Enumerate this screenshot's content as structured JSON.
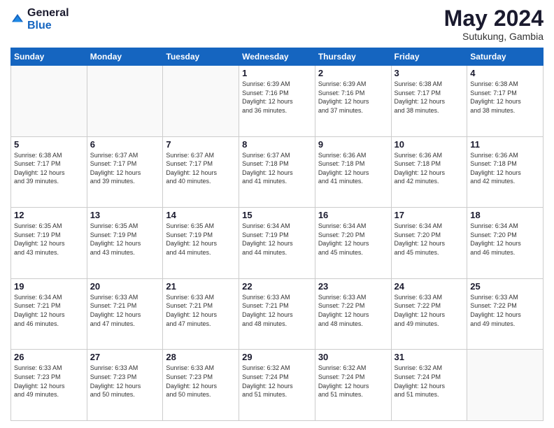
{
  "header": {
    "logo_line1": "General",
    "logo_line2": "Blue",
    "month_year": "May 2024",
    "location": "Sutukung, Gambia"
  },
  "weekdays": [
    "Sunday",
    "Monday",
    "Tuesday",
    "Wednesday",
    "Thursday",
    "Friday",
    "Saturday"
  ],
  "weeks": [
    [
      {
        "day": "",
        "info": ""
      },
      {
        "day": "",
        "info": ""
      },
      {
        "day": "",
        "info": ""
      },
      {
        "day": "1",
        "info": "Sunrise: 6:39 AM\nSunset: 7:16 PM\nDaylight: 12 hours\nand 36 minutes."
      },
      {
        "day": "2",
        "info": "Sunrise: 6:39 AM\nSunset: 7:16 PM\nDaylight: 12 hours\nand 37 minutes."
      },
      {
        "day": "3",
        "info": "Sunrise: 6:38 AM\nSunset: 7:17 PM\nDaylight: 12 hours\nand 38 minutes."
      },
      {
        "day": "4",
        "info": "Sunrise: 6:38 AM\nSunset: 7:17 PM\nDaylight: 12 hours\nand 38 minutes."
      }
    ],
    [
      {
        "day": "5",
        "info": "Sunrise: 6:38 AM\nSunset: 7:17 PM\nDaylight: 12 hours\nand 39 minutes."
      },
      {
        "day": "6",
        "info": "Sunrise: 6:37 AM\nSunset: 7:17 PM\nDaylight: 12 hours\nand 39 minutes."
      },
      {
        "day": "7",
        "info": "Sunrise: 6:37 AM\nSunset: 7:17 PM\nDaylight: 12 hours\nand 40 minutes."
      },
      {
        "day": "8",
        "info": "Sunrise: 6:37 AM\nSunset: 7:18 PM\nDaylight: 12 hours\nand 41 minutes."
      },
      {
        "day": "9",
        "info": "Sunrise: 6:36 AM\nSunset: 7:18 PM\nDaylight: 12 hours\nand 41 minutes."
      },
      {
        "day": "10",
        "info": "Sunrise: 6:36 AM\nSunset: 7:18 PM\nDaylight: 12 hours\nand 42 minutes."
      },
      {
        "day": "11",
        "info": "Sunrise: 6:36 AM\nSunset: 7:18 PM\nDaylight: 12 hours\nand 42 minutes."
      }
    ],
    [
      {
        "day": "12",
        "info": "Sunrise: 6:35 AM\nSunset: 7:19 PM\nDaylight: 12 hours\nand 43 minutes."
      },
      {
        "day": "13",
        "info": "Sunrise: 6:35 AM\nSunset: 7:19 PM\nDaylight: 12 hours\nand 43 minutes."
      },
      {
        "day": "14",
        "info": "Sunrise: 6:35 AM\nSunset: 7:19 PM\nDaylight: 12 hours\nand 44 minutes."
      },
      {
        "day": "15",
        "info": "Sunrise: 6:34 AM\nSunset: 7:19 PM\nDaylight: 12 hours\nand 44 minutes."
      },
      {
        "day": "16",
        "info": "Sunrise: 6:34 AM\nSunset: 7:20 PM\nDaylight: 12 hours\nand 45 minutes."
      },
      {
        "day": "17",
        "info": "Sunrise: 6:34 AM\nSunset: 7:20 PM\nDaylight: 12 hours\nand 45 minutes."
      },
      {
        "day": "18",
        "info": "Sunrise: 6:34 AM\nSunset: 7:20 PM\nDaylight: 12 hours\nand 46 minutes."
      }
    ],
    [
      {
        "day": "19",
        "info": "Sunrise: 6:34 AM\nSunset: 7:21 PM\nDaylight: 12 hours\nand 46 minutes."
      },
      {
        "day": "20",
        "info": "Sunrise: 6:33 AM\nSunset: 7:21 PM\nDaylight: 12 hours\nand 47 minutes."
      },
      {
        "day": "21",
        "info": "Sunrise: 6:33 AM\nSunset: 7:21 PM\nDaylight: 12 hours\nand 47 minutes."
      },
      {
        "day": "22",
        "info": "Sunrise: 6:33 AM\nSunset: 7:21 PM\nDaylight: 12 hours\nand 48 minutes."
      },
      {
        "day": "23",
        "info": "Sunrise: 6:33 AM\nSunset: 7:22 PM\nDaylight: 12 hours\nand 48 minutes."
      },
      {
        "day": "24",
        "info": "Sunrise: 6:33 AM\nSunset: 7:22 PM\nDaylight: 12 hours\nand 49 minutes."
      },
      {
        "day": "25",
        "info": "Sunrise: 6:33 AM\nSunset: 7:22 PM\nDaylight: 12 hours\nand 49 minutes."
      }
    ],
    [
      {
        "day": "26",
        "info": "Sunrise: 6:33 AM\nSunset: 7:23 PM\nDaylight: 12 hours\nand 49 minutes."
      },
      {
        "day": "27",
        "info": "Sunrise: 6:33 AM\nSunset: 7:23 PM\nDaylight: 12 hours\nand 50 minutes."
      },
      {
        "day": "28",
        "info": "Sunrise: 6:33 AM\nSunset: 7:23 PM\nDaylight: 12 hours\nand 50 minutes."
      },
      {
        "day": "29",
        "info": "Sunrise: 6:32 AM\nSunset: 7:24 PM\nDaylight: 12 hours\nand 51 minutes."
      },
      {
        "day": "30",
        "info": "Sunrise: 6:32 AM\nSunset: 7:24 PM\nDaylight: 12 hours\nand 51 minutes."
      },
      {
        "day": "31",
        "info": "Sunrise: 6:32 AM\nSunset: 7:24 PM\nDaylight: 12 hours\nand 51 minutes."
      },
      {
        "day": "",
        "info": ""
      }
    ]
  ]
}
